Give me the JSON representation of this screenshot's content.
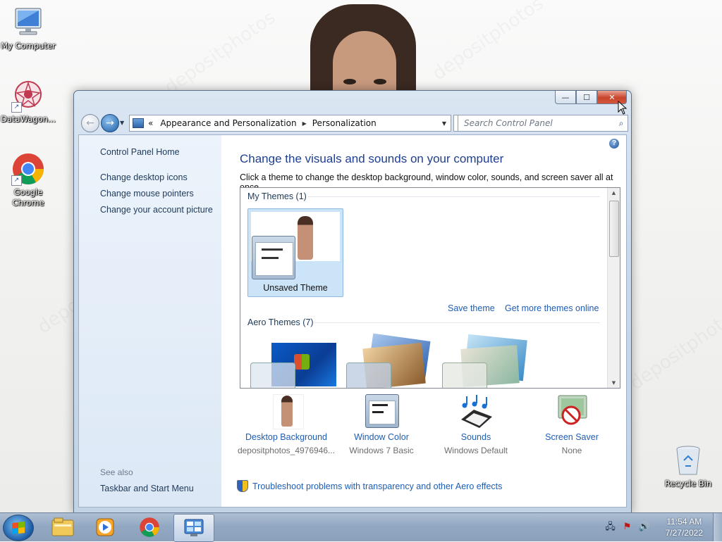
{
  "desktop": {
    "icons": [
      {
        "label": "My Computer"
      },
      {
        "label": "DataWagon..."
      },
      {
        "label": "Google\nChrome"
      },
      {
        "label": "Recycle Bin"
      }
    ],
    "watermark": "depositphotos"
  },
  "window": {
    "controls": {
      "minimize": "—",
      "maximize": "☐",
      "close": "✕"
    },
    "breadcrumb": {
      "overflow": "«",
      "items": [
        "Appearance and Personalization",
        "Personalization"
      ],
      "separator": "▶"
    },
    "search": {
      "placeholder": "Search Control Panel"
    },
    "sidebar": {
      "home": "Control Panel Home",
      "links": [
        "Change desktop icons",
        "Change mouse pointers",
        "Change your account picture"
      ],
      "see_also_label": "See also",
      "see_also_links": [
        "Taskbar and Start Menu"
      ]
    },
    "main": {
      "heading": "Change the visuals and sounds on your computer",
      "subtext": "Click a theme to change the desktop background, window color, sounds, and screen saver all at once.",
      "my_themes_label": "My Themes (1)",
      "selected_theme": "Unsaved Theme",
      "save_theme": "Save theme",
      "get_more_themes": "Get more themes online",
      "aero_themes_label": "Aero Themes (7)",
      "settings": [
        {
          "title": "Desktop Background",
          "value": "depositphotos_4976946..."
        },
        {
          "title": "Window Color",
          "value": "Windows 7 Basic"
        },
        {
          "title": "Sounds",
          "value": "Windows Default"
        },
        {
          "title": "Screen Saver",
          "value": "None"
        }
      ],
      "troubleshoot": "Troubleshoot problems with transparency and other Aero effects"
    }
  },
  "taskbar": {
    "clock": {
      "time": "11:54 AM",
      "date": "7/27/2022"
    },
    "pinned": [
      "file-explorer-icon",
      "media-player-icon",
      "chrome-icon",
      "control-panel-icon"
    ]
  },
  "colors": {
    "link": "#1e5db5",
    "heading": "#1e3f8f",
    "sidebar_text": "#1e3959",
    "close_button": "#c8442b"
  }
}
